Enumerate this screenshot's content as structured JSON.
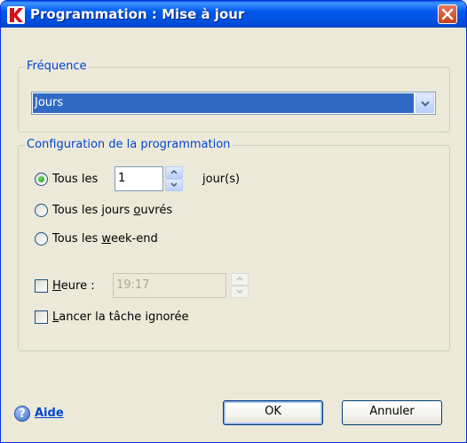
{
  "window": {
    "title": "Programmation : Mise à jour",
    "accent_color": "#0058ee",
    "icons": {
      "app": "kaspersky-k-icon",
      "close": "close-icon"
    }
  },
  "frequency": {
    "label": "Fréquence",
    "selected": "Jours"
  },
  "schedule": {
    "label": "Configuration de la programmation",
    "every_n": {
      "label": "Tous les",
      "value": "1",
      "unit": "jour(s)",
      "checked": true
    },
    "weekdays": {
      "label_pre": "Tous les jours ",
      "label_hotkey": "o",
      "label_post": "uvrés",
      "checked": false
    },
    "weekend": {
      "label_pre": "Tous les ",
      "label_hotkey": "w",
      "label_post": "eek-end",
      "checked": false
    },
    "time": {
      "label_hotkey": "H",
      "label_post": "eure :",
      "value": "19:17",
      "checked": false,
      "enabled": false
    },
    "run_skipped": {
      "label_hotkey": "L",
      "label_post": "ancer la tâche ignorée",
      "checked": false
    }
  },
  "footer": {
    "help_icon": "help-question-icon",
    "help_label": "Aide",
    "ok_label": "OK",
    "cancel_label": "Annuler"
  }
}
